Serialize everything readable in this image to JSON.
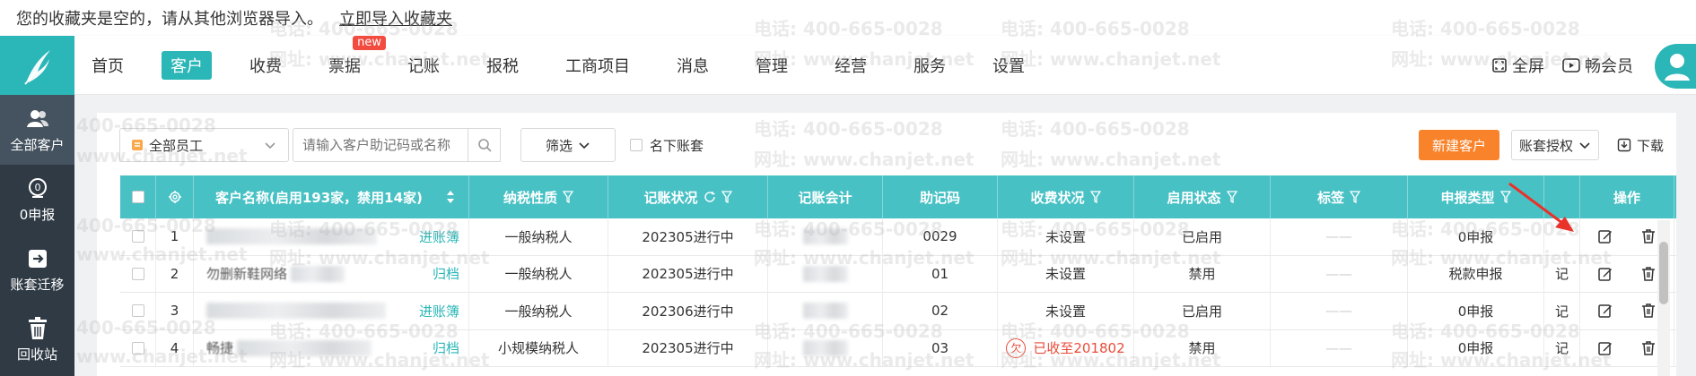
{
  "bookmark_bar": {
    "message": "您的收藏夹是空的，请从其他浏览器导入。",
    "import_link": "立即导入收藏夹"
  },
  "nav": {
    "items": [
      {
        "label": "首页",
        "active": false
      },
      {
        "label": "客户",
        "active": true
      },
      {
        "label": "收费",
        "active": false
      },
      {
        "label": "票据",
        "active": false,
        "badge": "new"
      },
      {
        "label": "记账",
        "active": false
      },
      {
        "label": "报税",
        "active": false
      },
      {
        "label": "工商项目",
        "active": false
      },
      {
        "label": "消息",
        "active": false
      },
      {
        "label": "管理",
        "active": false
      },
      {
        "label": "经营",
        "active": false
      },
      {
        "label": "服务",
        "active": false
      },
      {
        "label": "设置",
        "active": false
      }
    ],
    "fullscreen_label": "全屏",
    "vip_label": "畅会员"
  },
  "sidebar": {
    "items": [
      {
        "label": "全部客户",
        "icon": "users-icon"
      },
      {
        "label": "0申报",
        "icon": "zero-report-icon"
      },
      {
        "label": "账套迁移",
        "icon": "migrate-icon"
      },
      {
        "label": "回收站",
        "icon": "trash-icon"
      }
    ]
  },
  "toolbar": {
    "employee_select": "全部员工",
    "search_placeholder": "请输入客户助记码或名称",
    "filter_label": "筛选",
    "checkbox_label": "名下账套",
    "new_client_label": "新建客户",
    "auth_label": "账套授权",
    "download_label": "下载"
  },
  "table": {
    "headers": [
      "客户名称(启用193家，禁用14家)",
      "纳税性质",
      "记账状况",
      "记账会计",
      "助记码",
      "收费状况",
      "启用状态",
      "标签",
      "申报类型",
      "操作"
    ],
    "rows": [
      {
        "index": "1",
        "name_link": "进账簿",
        "tax": "一般纳税人",
        "status": "202305进行中",
        "code": "0029",
        "fee": "未设置",
        "fee_red": false,
        "enabled": "已启用",
        "tag": "——",
        "report": "0申报",
        "extra": ""
      },
      {
        "index": "2",
        "name_text": "勿删新鞋网络",
        "name_link": "归档",
        "tax": "一般纳税人",
        "status": "202305进行中",
        "code": "01",
        "fee": "未设置",
        "fee_red": false,
        "enabled": "禁用",
        "tag": "——",
        "report": "税款申报",
        "extra": "记"
      },
      {
        "index": "3",
        "name_link": "进账簿",
        "tax": "一般纳税人",
        "status": "202306进行中",
        "code": "02",
        "fee": "未设置",
        "fee_red": false,
        "enabled": "已启用",
        "tag": "——",
        "report": "0申报",
        "extra": "记"
      },
      {
        "index": "4",
        "name_text": "畅捷",
        "name_link": "归档",
        "tax": "小规模纳税人",
        "status": "202305进行中",
        "code": "03",
        "fee": "已收至201802",
        "fee_red": true,
        "fee_badge": "欠",
        "enabled": "禁用",
        "tag": "——",
        "report": "0申报",
        "extra": "记"
      }
    ]
  },
  "watermark": {
    "phone": "电话: 400-665-0028",
    "site": "网址: www.chanjet.net",
    "phone_partial": "400-665-0028",
    "site_partial": "www.chanjet.net"
  },
  "colors": {
    "teal": "#2bb6b7",
    "header_teal": "#48c1c5",
    "sidebar": "#2f3a45",
    "orange": "#f9832a",
    "red": "#e94b3a"
  }
}
